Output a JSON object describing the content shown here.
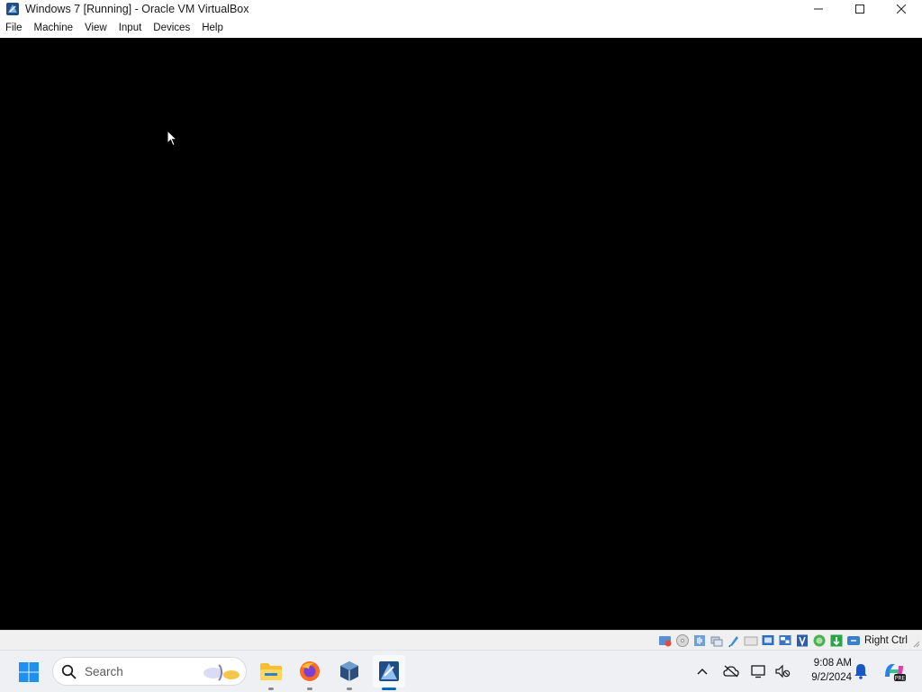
{
  "window": {
    "title": "Windows 7 [Running] - Oracle VM VirtualBox",
    "controls": [
      "minimize-icon",
      "maximize-icon",
      "close-icon"
    ]
  },
  "menubar": {
    "items": [
      {
        "label": "File"
      },
      {
        "label": "Machine"
      },
      {
        "label": "View"
      },
      {
        "label": "Input"
      },
      {
        "label": "Devices"
      },
      {
        "label": "Help"
      }
    ]
  },
  "vm": {
    "state": "running",
    "background": "#000000"
  },
  "statusbar": {
    "icons": [
      "hard-disk-icon",
      "optical-drive-icon",
      "audio-icon",
      "network-icon",
      "usb-icon",
      "shared-folders-icon",
      "display-icon",
      "video-capture-icon",
      "mouse-integration-icon",
      "cpu-icon",
      "arrow-icon",
      "keyboard-icon"
    ],
    "host_key": "Right Ctrl"
  },
  "taskbar": {
    "search_placeholder": "Search",
    "apps": [
      {
        "name": "file-explorer",
        "active": false
      },
      {
        "name": "firefox",
        "active": false
      },
      {
        "name": "virtualbox-manager",
        "active": false
      },
      {
        "name": "virtualbox-vm",
        "active": true
      }
    ],
    "tray": {
      "icons": [
        "chevron-up-icon",
        "onedrive-icon",
        "display-icon",
        "volume-muted-icon",
        "notification-bell-icon",
        "copilot-icon"
      ],
      "time": "9:08 AM",
      "date": "9/2/2024"
    }
  },
  "colors": {
    "accent": "#0067c0",
    "taskbar_bg": "#eef0f3",
    "statusbar_bg": "#f0f0f0"
  }
}
